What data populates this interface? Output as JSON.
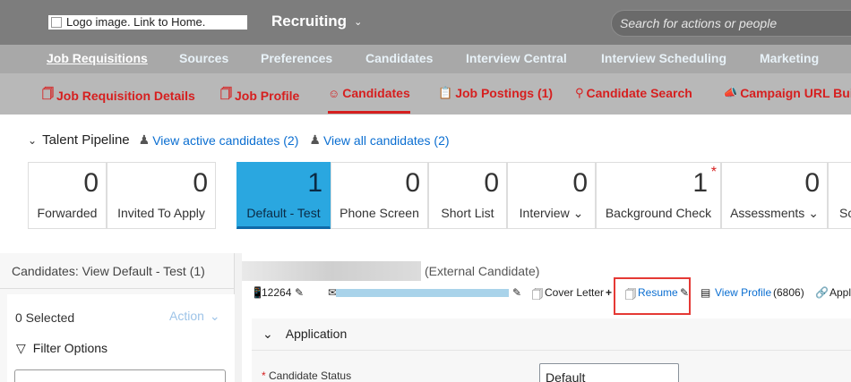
{
  "shell": {
    "logo_alt": "Logo image. Link to Home.",
    "module": "Recruiting",
    "search_placeholder": "Search for actions or people"
  },
  "nav2": [
    "Job Requisitions",
    "Sources",
    "Preferences",
    "Candidates",
    "Interview Central",
    "Interview Scheduling",
    "Marketing"
  ],
  "tabs": [
    "Job Requisition Details",
    "Job Profile",
    "Candidates",
    "Job Postings (1)",
    "Candidate Search",
    "Campaign URL Bui"
  ],
  "pipeline": {
    "title": "Talent Pipeline",
    "view_active": "View active candidates (2)",
    "view_all": "View all candidates (2)",
    "stages": [
      {
        "count": "0",
        "label": "Forwarded"
      },
      {
        "count": "0",
        "label": "Invited To Apply"
      },
      {
        "count": "1",
        "label": "Default - Test"
      },
      {
        "count": "0",
        "label": "Phone Screen"
      },
      {
        "count": "0",
        "label": "Short List"
      },
      {
        "count": "0",
        "label": "Interview"
      },
      {
        "count": "1",
        "label": "Background Check"
      },
      {
        "count": "0",
        "label": "Assessments"
      },
      {
        "count": "",
        "label": "Sc"
      }
    ]
  },
  "left_panel": {
    "header": "Candidates: View Default - Test (1)",
    "selected": "0 Selected",
    "action": "Action",
    "filter": "Filter Options"
  },
  "candidate": {
    "type": "(External Candidate)",
    "phone": "12264",
    "cover_letter": "Cover Letter",
    "resume": "Resume",
    "view_profile": "View Profile",
    "profile_count": "(6806)",
    "appl": "Appl",
    "section": "Application",
    "status_label": "Candidate Status",
    "status_value": "Default"
  }
}
